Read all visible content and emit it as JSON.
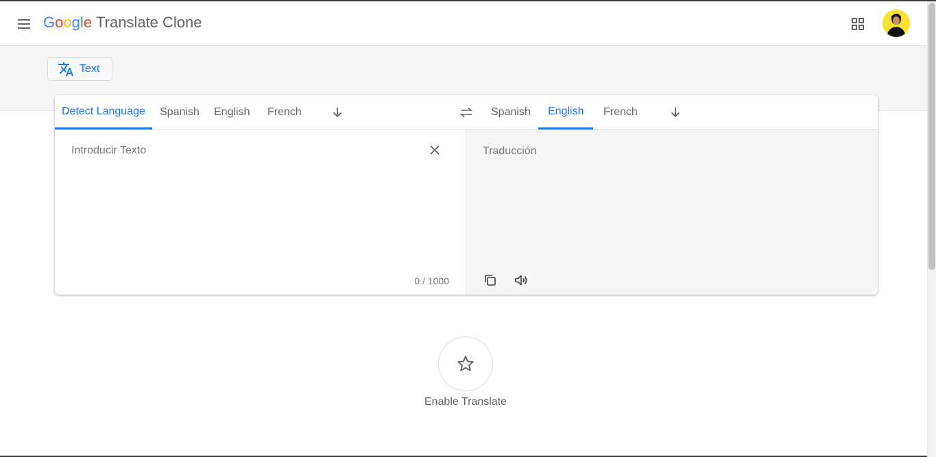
{
  "header": {
    "logo_letters": [
      "G",
      "o",
      "o",
      "g",
      "l",
      "e"
    ],
    "logo_colors": [
      "#4285f4",
      "#ea4335",
      "#fbbc05",
      "#4285f4",
      "#34a853",
      "#ea4335"
    ],
    "app_title": "Translate Clone"
  },
  "mode_button": {
    "label": "Text",
    "icon": "translate-icon"
  },
  "source": {
    "tabs": [
      "Detect Language",
      "Spanish",
      "English",
      "French"
    ],
    "active_tab": "Detect Language",
    "placeholder": "Introducir Texto",
    "value": "",
    "counter": "0 / 1000"
  },
  "target": {
    "tabs": [
      "Spanish",
      "English",
      "French"
    ],
    "active_tab": "English",
    "placeholder": "Traducción"
  },
  "favorite": {
    "label": "Enable Translate",
    "icon": "star-outline-icon"
  },
  "colors": {
    "accent": "#1a73e8",
    "target_bg": "#f5f5f5",
    "avatar_bg": "#f7e232"
  }
}
